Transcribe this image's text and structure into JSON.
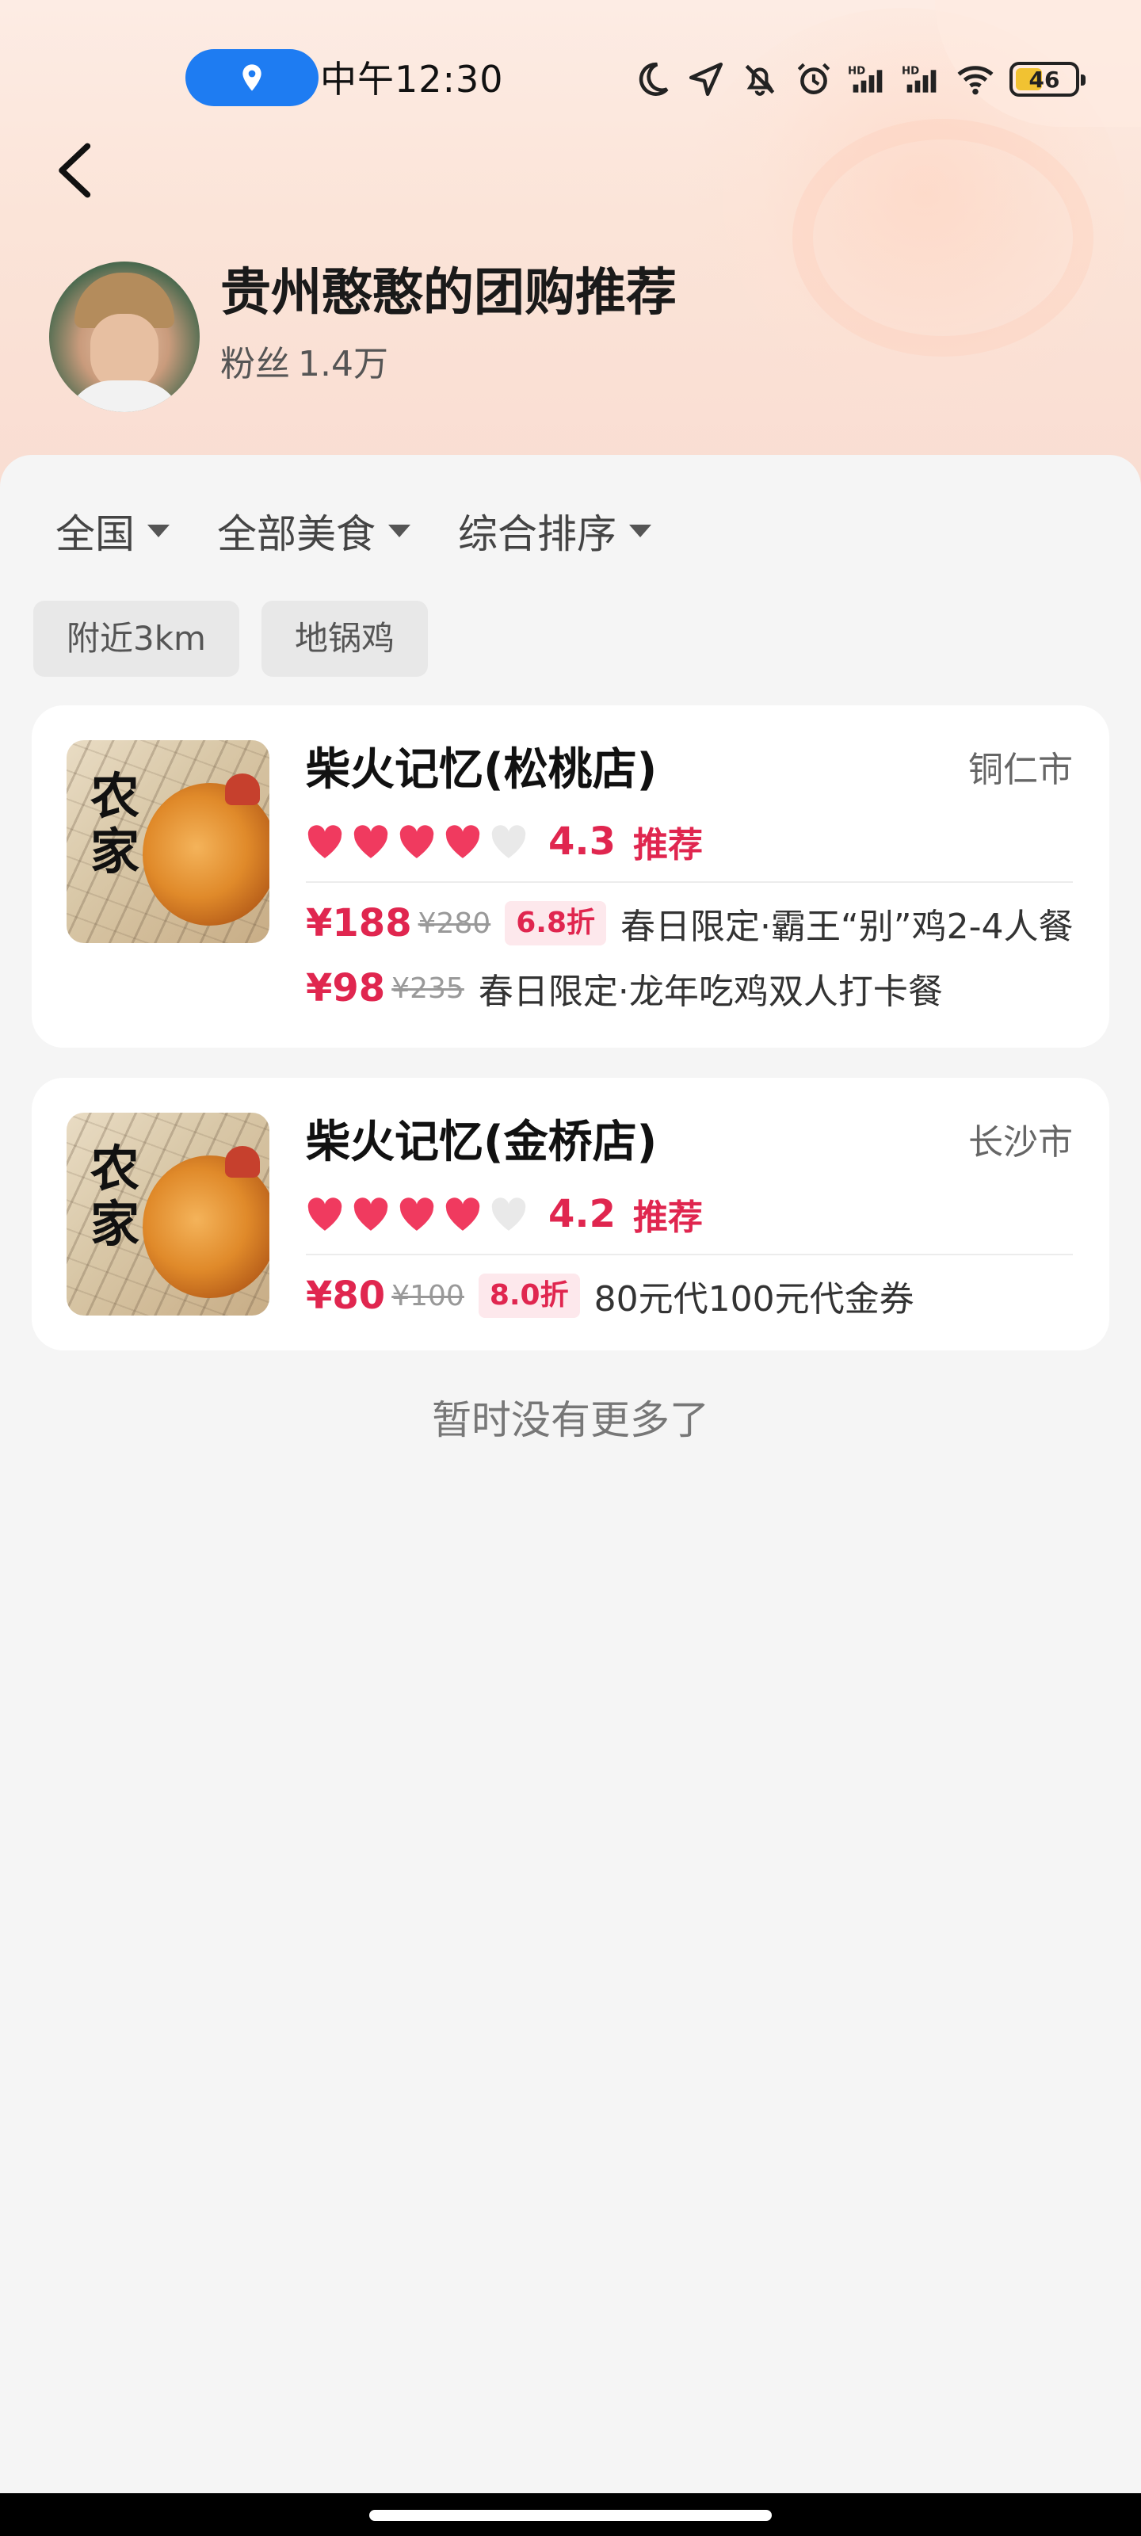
{
  "status_bar": {
    "time": "中午12:30",
    "battery": "46",
    "battery_level": 0.46,
    "icons": [
      "location-icon",
      "moon-icon",
      "navigation-icon",
      "mute-icon",
      "alarm-icon",
      "signal-hd-icon",
      "signal-hd-icon",
      "wifi-icon",
      "battery-icon"
    ]
  },
  "profile": {
    "name": "贵州憨憨的团购推荐",
    "fans_label": "粉丝",
    "fans_count": "1.4万"
  },
  "filters": [
    {
      "label": "全国"
    },
    {
      "label": "全部美食"
    },
    {
      "label": "综合排序"
    }
  ],
  "tags": [
    "附近3km",
    "地锅鸡"
  ],
  "stores": [
    {
      "name": "柴火记忆(松桃店)",
      "city": "铜仁市",
      "hearts_filled": 4,
      "hearts_total": 5,
      "score": "4.3",
      "badge": "推荐",
      "thumb_text": "农家散养",
      "deals": [
        {
          "price": "¥188",
          "original": "¥280",
          "discount": "6.8折",
          "name": "春日限定·霸王“别”鸡2-4人餐"
        },
        {
          "price": "¥98",
          "original": "¥235",
          "discount": "",
          "name": "春日限定·龙年吃鸡双人打卡餐"
        }
      ]
    },
    {
      "name": "柴火记忆(金桥店)",
      "city": "长沙市",
      "hearts_filled": 4,
      "hearts_total": 5,
      "score": "4.2",
      "badge": "推荐",
      "thumb_text": "农家散养",
      "deals": [
        {
          "price": "¥80",
          "original": "¥100",
          "discount": "8.0折",
          "name": "80元代100元代金券"
        }
      ]
    }
  ],
  "footer": {
    "no_more": "暂时没有更多了"
  },
  "colors": {
    "accent": "#e0264f",
    "location_pill": "#1e7cf2",
    "background": "#f5f5f5"
  }
}
